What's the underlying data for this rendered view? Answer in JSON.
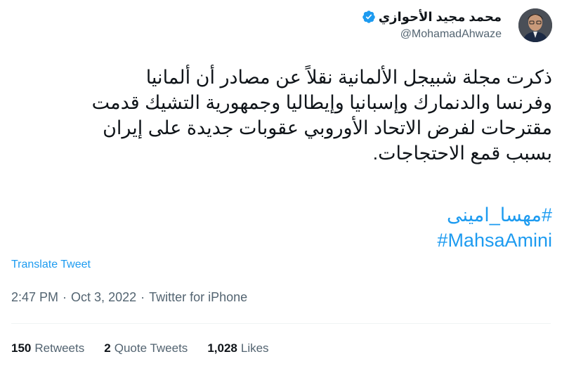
{
  "author": {
    "display_name": "محمد مجيد الأحوازي",
    "handle": "@MohamadAhwaze",
    "verified": true,
    "avatar_icon": "avatar-photo"
  },
  "tweet": {
    "text": "ذكرت مجلة شبيجل الألمانية نقلاً عن مصادر أن ألمانيا\nوفرنسا والدنمارك وإسبانيا وإيطاليا وجمهورية التشيك قدمت\nمقترحات لفرض الاتحاد الأوروبي عقوبات جديدة على إيران\nبسبب قمع الاحتجاجات.",
    "hashtags": [
      "#مهسا_امینی",
      "#MahsaAmini"
    ]
  },
  "translate_label": "Translate Tweet",
  "meta": {
    "time": "2:47 PM",
    "separator": "·",
    "date": "Oct 3, 2022",
    "source": "Twitter for iPhone"
  },
  "stats": {
    "retweets_count": "150",
    "retweets_label": "Retweets",
    "quotes_count": "2",
    "quotes_label": "Quote Tweets",
    "likes_count": "1,028",
    "likes_label": "Likes"
  },
  "colors": {
    "accent": "#1d9bf0",
    "secondary_text": "#536471",
    "primary_text": "#0f1419"
  }
}
